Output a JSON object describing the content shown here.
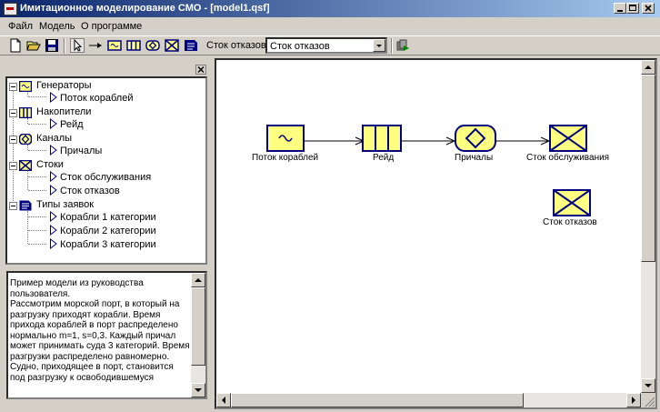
{
  "window": {
    "title": "Имитационное моделирование СМО - [model1.qsf]",
    "icon": "app-icon"
  },
  "menu": [
    "Файл",
    "Модель",
    "О программе"
  ],
  "toolbar": {
    "reject_label": "Сток отказов:",
    "reject_value": "Сток отказов"
  },
  "tree": {
    "groups": [
      {
        "label": "Генераторы",
        "icon": "generator-icon",
        "children": [
          "Поток кораблей"
        ]
      },
      {
        "label": "Накопители",
        "icon": "queue-icon",
        "children": [
          "Рейд"
        ]
      },
      {
        "label": "Каналы",
        "icon": "channel-icon",
        "children": [
          "Причалы"
        ]
      },
      {
        "label": "Стоки",
        "icon": "sink-icon",
        "children": [
          "Сток обслуживания",
          "Сток отказов"
        ]
      },
      {
        "label": "Типы заявок",
        "icon": "request-type-icon",
        "children": [
          "Корабли 1 категории",
          "Корабли 2 категории",
          "Корабли 3 категории"
        ]
      }
    ]
  },
  "description": "Пример модели из руководства пользователя.\n    Рассмотрим морской порт, в который на разгрузку приходят корабли. Время прихода кораблей в порт распределено нормально m=1, s=0,3. Каждый причал может принимать суда 3 категорий. Время разгрузки распределено равномерно.\n    Судно, приходящее в порт, становится под разгрузку к освободившемуся",
  "diagram": {
    "blocks": {
      "generator": "Поток кораблей",
      "queue": "Рейд",
      "channel": "Причалы",
      "sink_service": "Сток обслуживания",
      "sink_reject": "Сток отказов"
    }
  },
  "colors": {
    "block_fill": "#ffff80",
    "block_border": "#000080",
    "selection": "#0a246a"
  }
}
